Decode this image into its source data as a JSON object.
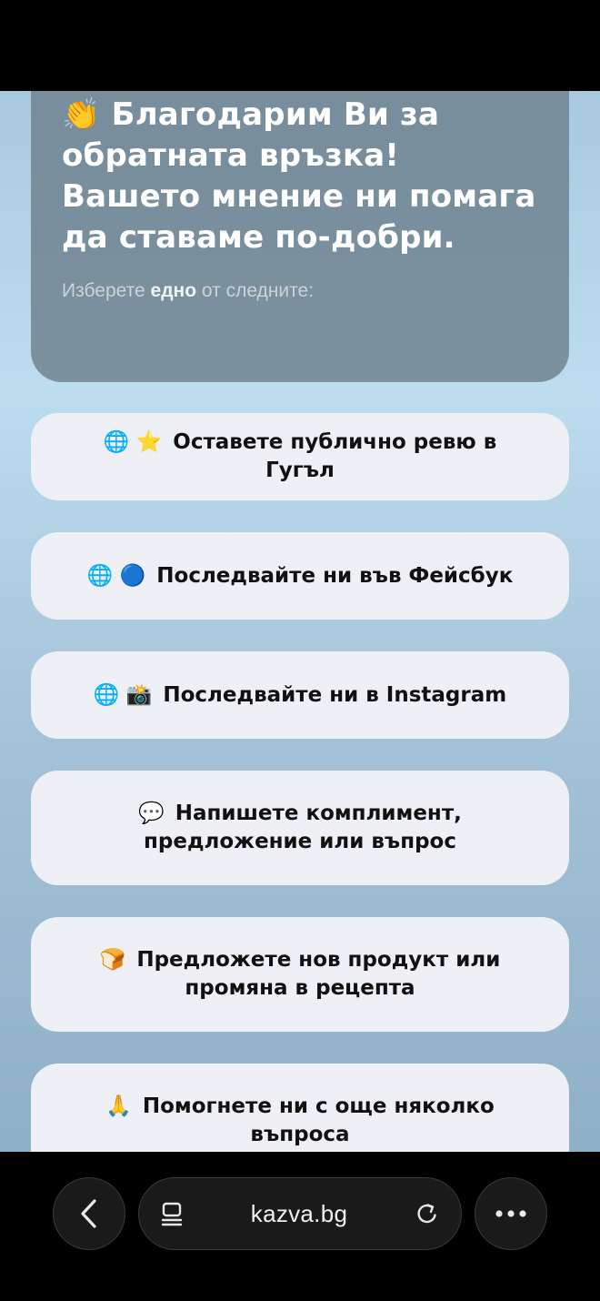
{
  "header": {
    "icon": "clapping-hands-icon",
    "emoji": "👏",
    "title": "Благодарим Ви за обратната връзка! Вашето мнение ни помага да ставаме по-добри.",
    "hint_prefix": "Изберете",
    "hint_bold": "едно",
    "hint_suffix": "от следните:"
  },
  "options": [
    {
      "icons": [
        "globe-icon",
        "star-icon"
      ],
      "emoji": "🌐 ⭐",
      "label": "Оставете публично ревю в Гугъл"
    },
    {
      "icons": [
        "globe-icon",
        "blue-circle-icon"
      ],
      "emoji": "🌐 🔵",
      "label": "Последвайте ни във Фейсбук"
    },
    {
      "icons": [
        "globe-icon",
        "camera-flash-icon"
      ],
      "emoji": "🌐 📸",
      "label": "Последвайте ни в Instagram"
    },
    {
      "icons": [
        "speech-bubble-icon"
      ],
      "emoji": "💬",
      "label": "Напишете комплимент, предложение или въпрос"
    },
    {
      "icons": [
        "bread-icon"
      ],
      "emoji": "🍞",
      "label": "Предложете нов продукт или промяна в рецепта"
    },
    {
      "icons": [
        "folded-hands-icon"
      ],
      "emoji": "🙏",
      "label": "Помогнете ни с още няколко въпроса"
    }
  ],
  "browser": {
    "url": "kazva.bg",
    "icons": [
      "back-chevron-icon",
      "page-menu-icon",
      "reload-icon",
      "more-dots-icon"
    ]
  },
  "colors": {
    "header_card": "#6e808c",
    "option_bg": "#eef0f5",
    "background_top": "#a9c9df",
    "background_bottom": "#8eb0c7"
  }
}
